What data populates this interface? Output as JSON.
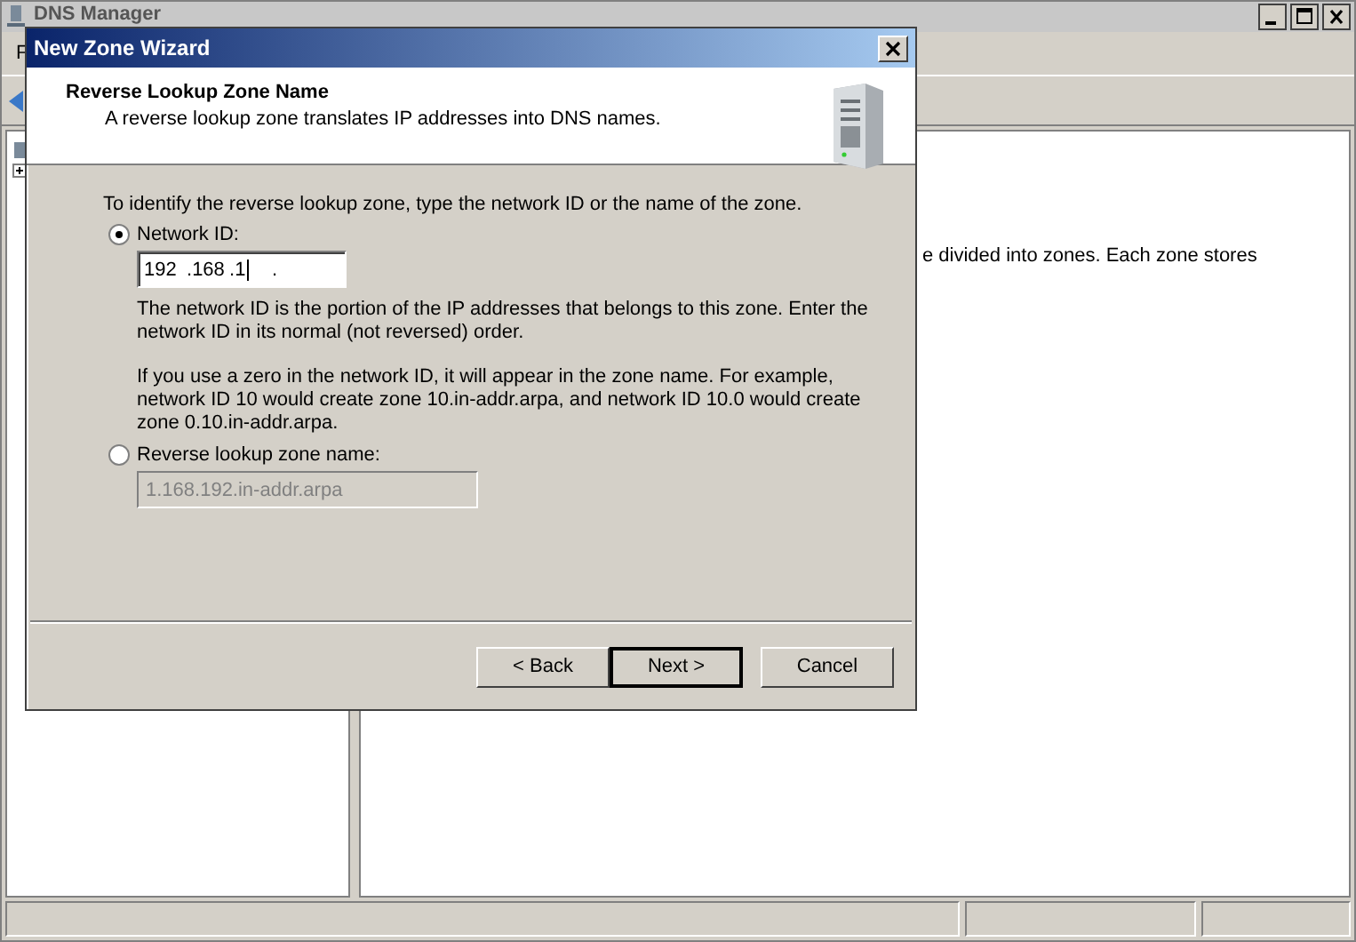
{
  "main_window": {
    "title": "DNS Manager",
    "menu": [
      "F"
    ],
    "content_text": "e divided into zones. Each zone stores"
  },
  "dialog": {
    "title": "New Zone Wizard",
    "header": {
      "title": "Reverse Lookup Zone Name",
      "subtitle": "A reverse lookup zone translates IP addresses into DNS names."
    },
    "intro": "To identify the reverse lookup zone, type the network ID or the name of the zone.",
    "options": [
      {
        "kind": "ip",
        "label": "Network ID:",
        "selected": true,
        "segments": [
          "192",
          "168",
          "1"
        ],
        "separator": ".",
        "focused": true,
        "notes": [
          "The network ID is the portion of the IP addresses that belongs to this zone. Enter the network ID in its normal (not reversed) order.",
          "If you use a zero in the network ID, it will appear in the zone name. For example, network ID 10 would create zone 10.in-addr.arpa, and network ID 10.0 would create zone 0.10.in-addr.arpa."
        ]
      },
      {
        "kind": "text",
        "label": "Reverse lookup zone name:",
        "selected": false,
        "value": "1.168.192.in-addr.arpa",
        "disabled": true
      }
    ],
    "buttons": [
      {
        "label": "< Back",
        "default": false
      },
      {
        "label": "Next >",
        "default": true
      },
      {
        "label": "Cancel",
        "default": false
      }
    ]
  }
}
